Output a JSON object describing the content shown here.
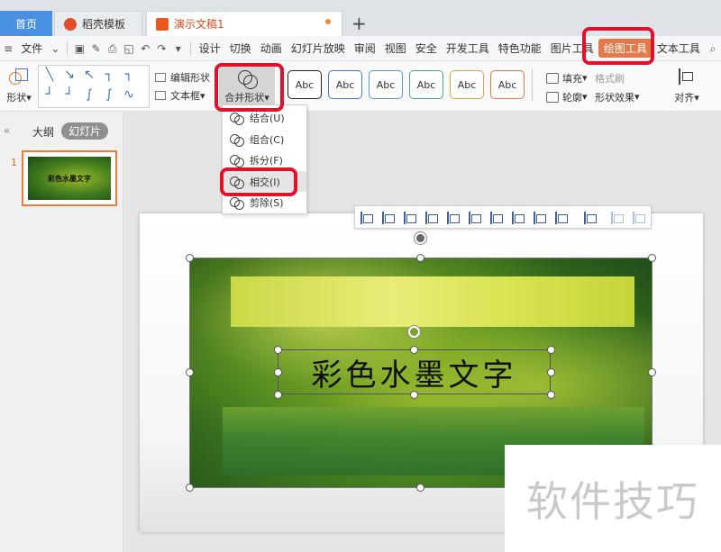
{
  "tabs": {
    "home": "首页",
    "template": "稻壳模板",
    "document": "演示文稿1",
    "add": "+"
  },
  "menu": {
    "file": "文件",
    "items": [
      "设计",
      "切换",
      "动画",
      "幻灯片放映",
      "审阅",
      "视图",
      "安全",
      "开发工具",
      "特色功能",
      "图片工具",
      "绘图工具",
      "文本工具"
    ],
    "active": "绘图工具"
  },
  "ribbon": {
    "shape": "形状",
    "edit_shape": "编辑形状",
    "textbox": "文本框",
    "merge_shapes": "合并形状",
    "styles": [
      "Abc",
      "Abc",
      "Abc",
      "Abc",
      "Abc",
      "Abc"
    ],
    "style_colors": [
      "#222222",
      "#4a7ac8",
      "#5a9bd5",
      "#4aa88a",
      "#e3a33c",
      "#e3794a"
    ],
    "fill": "填充",
    "outline": "轮廓",
    "format_painter": "格式刷",
    "shape_effects": "形状效果",
    "align": "对齐"
  },
  "left_panel": {
    "outline_tab": "大纲",
    "slides_tab": "幻灯片",
    "slide_number": "1",
    "thumb_text": "彩色水墨文字"
  },
  "merge_menu": {
    "items": [
      {
        "label": "结合(U)"
      },
      {
        "label": "组合(C)"
      },
      {
        "label": "拆分(F)"
      },
      {
        "label": "相交(I)"
      },
      {
        "label": "剪除(S)"
      }
    ],
    "selected": "相交(I)"
  },
  "slide": {
    "text": "彩色水墨文字"
  },
  "watermark": "软件技巧"
}
